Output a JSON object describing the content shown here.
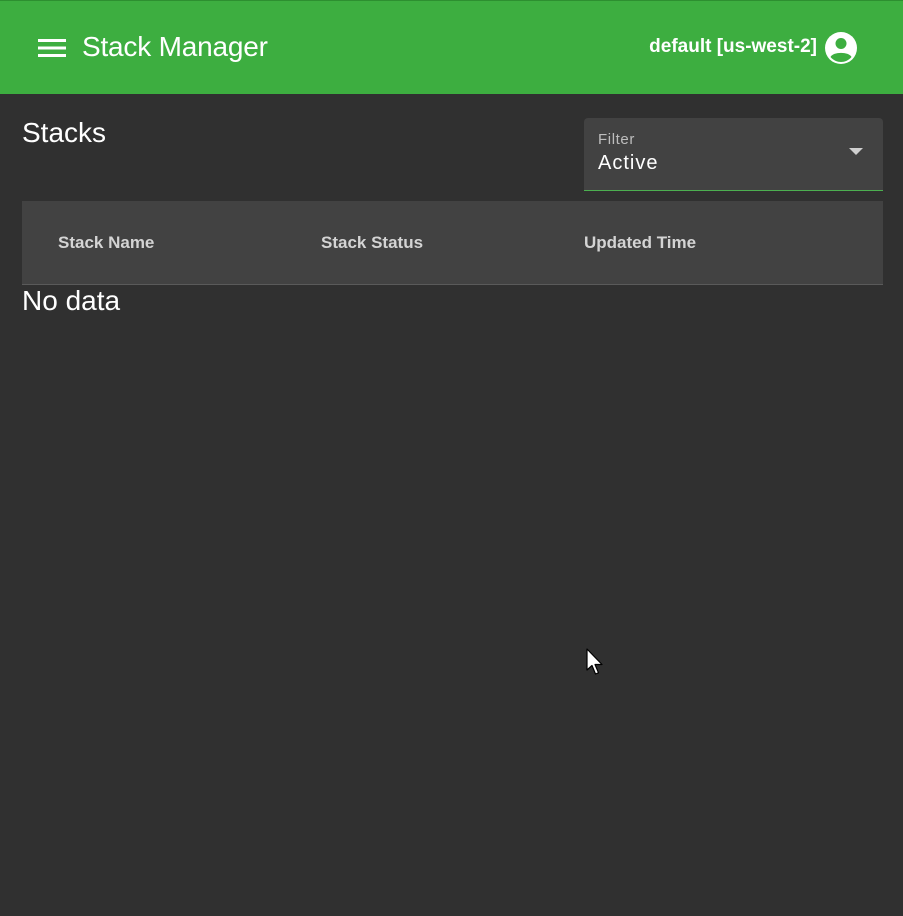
{
  "appbar": {
    "title": "Stack Manager",
    "profile": "default [us-west-2]",
    "color": "#3dae40",
    "menu_icon": "hamburger-menu-icon",
    "account_icon": "account-circle-icon"
  },
  "page": {
    "heading": "Stacks"
  },
  "filter": {
    "label": "Filter",
    "value": "Active",
    "accent": "#4caf50"
  },
  "table": {
    "columns": [
      "Stack Name",
      "Stack Status",
      "Updated Time"
    ],
    "rows": [],
    "empty_text": "No data"
  }
}
